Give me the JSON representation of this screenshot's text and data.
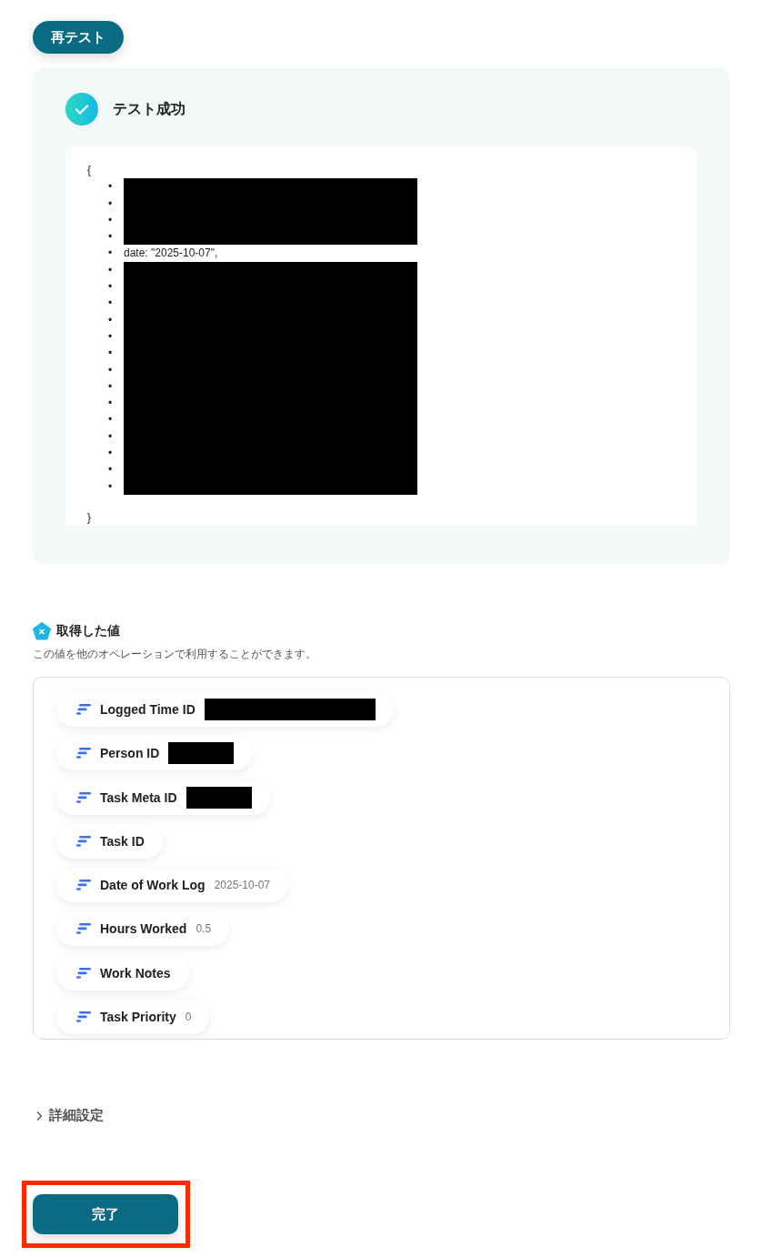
{
  "retest_button": {
    "label": "再テスト"
  },
  "test_result": {
    "success": true,
    "title": "テスト成功",
    "json_output": {
      "open": "{",
      "close": "}",
      "lines": [
        {
          "kind": "redacted",
          "marker": "•"
        },
        {
          "kind": "redacted",
          "marker": "•"
        },
        {
          "kind": "redacted",
          "marker": "•"
        },
        {
          "kind": "redacted",
          "marker": "•"
        },
        {
          "kind": "text",
          "marker": "•",
          "text": "date: \"2025-10-07\","
        },
        {
          "kind": "redacted",
          "marker": "•"
        },
        {
          "kind": "redacted",
          "marker": "•"
        },
        {
          "kind": "redacted",
          "marker": "•"
        },
        {
          "kind": "redacted",
          "marker": "•"
        },
        {
          "kind": "redacted",
          "marker": "•"
        },
        {
          "kind": "redacted",
          "marker": "•"
        },
        {
          "kind": "redacted",
          "marker": "•"
        },
        {
          "kind": "redacted",
          "marker": "•"
        },
        {
          "kind": "redacted",
          "marker": "•"
        },
        {
          "kind": "redacted",
          "marker": "•"
        },
        {
          "kind": "redacted",
          "marker": "•"
        },
        {
          "kind": "redacted",
          "marker": "•"
        },
        {
          "kind": "redacted",
          "marker": "•"
        },
        {
          "kind": "redacted",
          "marker": "•"
        }
      ]
    }
  },
  "fetched_values": {
    "title": "取得した値",
    "description": "この値を他のオペレーションで利用することができます。",
    "items": [
      {
        "label": "Logged Time ID",
        "redacted": true
      },
      {
        "label": "Person ID",
        "redacted": true
      },
      {
        "label": "Task Meta ID",
        "redacted": true
      },
      {
        "label": "Task ID",
        "redacted": false
      },
      {
        "label": "Date of Work Log",
        "redacted": false,
        "value": "2025-10-07"
      },
      {
        "label": "Hours Worked",
        "redacted": false,
        "value": "0.5"
      },
      {
        "label": "Work Notes",
        "redacted": false
      },
      {
        "label": "Task Priority",
        "redacted": false,
        "value": "0"
      }
    ]
  },
  "advanced_settings": {
    "label": "詳細設定",
    "expanded": false
  },
  "done_button": {
    "label": "完了",
    "highlighted": true
  }
}
